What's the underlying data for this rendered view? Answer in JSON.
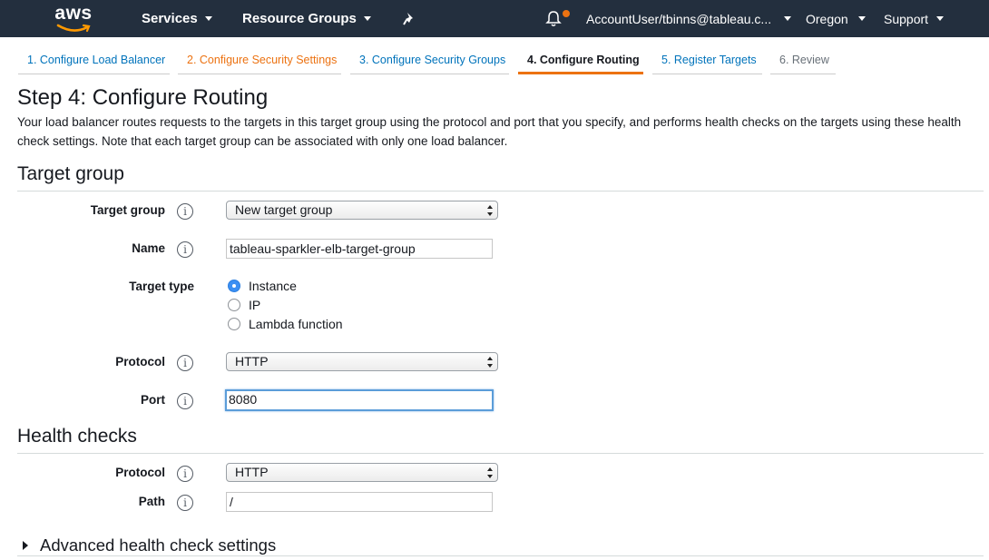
{
  "nav": {
    "logo": "aws",
    "services": "Services",
    "resource_groups": "Resource Groups",
    "pin_icon": "pin-icon",
    "bell_icon": "bell-icon",
    "account": "AccountUser/tbinns@tableau.c...",
    "region": "Oregon",
    "support": "Support",
    "colors": {
      "bar": "#232f3e",
      "notification": "#ec7211"
    }
  },
  "wizard": {
    "tabs": [
      {
        "label": "1. Configure Load Balancer",
        "state": "completed"
      },
      {
        "label": "2. Configure Security Settings",
        "state": "warning"
      },
      {
        "label": "3. Configure Security Groups",
        "state": "completed"
      },
      {
        "label": "4. Configure Routing",
        "state": "active"
      },
      {
        "label": "5. Register Targets",
        "state": "next"
      },
      {
        "label": "6. Review",
        "state": "future"
      }
    ]
  },
  "page": {
    "title": "Step 4: Configure Routing",
    "description": "Your load balancer routes requests to the targets in this target group using the protocol and port that you specify, and performs health checks on the targets using these health check settings. Note that each target group can be associated with only one load balancer."
  },
  "target_group": {
    "heading": "Target group",
    "target_group_label": "Target group",
    "target_group_value": "New target group",
    "name_label": "Name",
    "name_value": "tableau-sparkler-elb-target-group",
    "target_type_label": "Target type",
    "target_type_options": [
      {
        "label": "Instance",
        "selected": true
      },
      {
        "label": "IP",
        "selected": false
      },
      {
        "label": "Lambda function",
        "selected": false
      }
    ],
    "protocol_label": "Protocol",
    "protocol_value": "HTTP",
    "port_label": "Port",
    "port_value": "8080"
  },
  "health_checks": {
    "heading": "Health checks",
    "protocol_label": "Protocol",
    "protocol_value": "HTTP",
    "path_label": "Path",
    "path_value": "/",
    "advanced_label": "Advanced health check settings"
  },
  "info_glyph": "i"
}
